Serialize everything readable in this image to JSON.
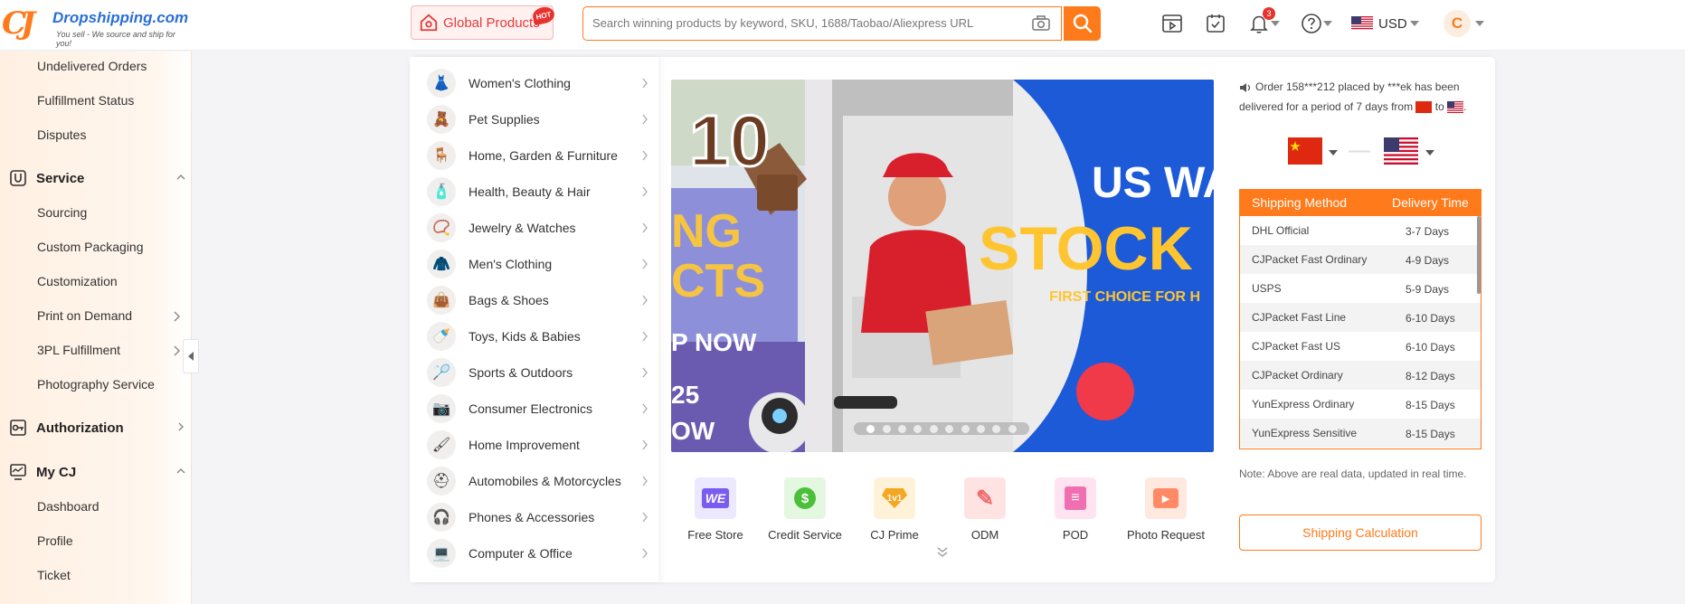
{
  "header": {
    "logo_mark": "CJ",
    "logo_name": "Dropshipping.com",
    "logo_tagline": "You sell - We source and ship for you!",
    "global_products_label": "Global Products",
    "hot_badge": "HOT",
    "search_placeholder": "Search winning products by keyword, SKU, 1688/Taobao/Aliexpress URL",
    "notification_count": "3",
    "currency": "USD",
    "avatar_initial": "C"
  },
  "sidebar": {
    "top_items": [
      "Undelivered Orders",
      "Fulfillment Status",
      "Disputes"
    ],
    "service": {
      "label": "Service",
      "items": [
        "Sourcing",
        "Custom Packaging",
        "Customization",
        "Print on Demand",
        "3PL Fulfillment",
        "Photography Service"
      ]
    },
    "authorization": {
      "label": "Authorization"
    },
    "my_cj": {
      "label": "My CJ",
      "items": [
        "Dashboard",
        "Profile",
        "Ticket"
      ]
    }
  },
  "categories": [
    "Women's Clothing",
    "Pet Supplies",
    "Home, Garden & Furniture",
    "Health, Beauty & Hair",
    "Jewelry & Watches",
    "Men's Clothing",
    "Bags & Shoes",
    "Toys, Kids & Babies",
    "Sports & Outdoors",
    "Consumer Electronics",
    "Home Improvement",
    "Automobiles & Motorcycles",
    "Phones & Accessories",
    "Computer & Office"
  ],
  "banner": {
    "left_number": "10",
    "left_line1": "NG",
    "left_line2": "CTS",
    "left_line3": "P NOW",
    "left_line4": "25",
    "left_line5": "OW",
    "headline1": "US WAR",
    "headline2": "STOCK DI",
    "subline": "FIRST CHOICE FOR H",
    "slide_count": 10,
    "active_slide": 1
  },
  "services": [
    {
      "label": "Free Store",
      "color": "#7b5cf0",
      "glyph": "WE"
    },
    {
      "label": "Credit Service",
      "color": "#4bbf3a",
      "glyph": "$"
    },
    {
      "label": "CJ Prime",
      "color": "#f5a623",
      "glyph": "1v1"
    },
    {
      "label": "ODM",
      "color": "#f26b6b",
      "glyph": "✎"
    },
    {
      "label": "POD",
      "color": "#f06fb0",
      "glyph": "≡"
    },
    {
      "label": "Photo Request",
      "color": "#ff8a65",
      "glyph": "▶"
    }
  ],
  "right_panel": {
    "notice_line1": "Order 158***212 placed by ***ek has been",
    "notice_line2": "delivered for a period of 7 days from",
    "notice_to": "to",
    "notice_end": ".",
    "table_header_method": "Shipping Method",
    "table_header_time": "Delivery Time",
    "rows": [
      {
        "method": "DHL Official",
        "time": "3-7 Days"
      },
      {
        "method": "CJPacket Fast Ordinary",
        "time": "4-9 Days"
      },
      {
        "method": "USPS",
        "time": "5-9 Days"
      },
      {
        "method": "CJPacket Fast Line",
        "time": "6-10 Days"
      },
      {
        "method": "CJPacket Fast US",
        "time": "6-10 Days"
      },
      {
        "method": "CJPacket Ordinary",
        "time": "8-12 Days"
      },
      {
        "method": "YunExpress Ordinary",
        "time": "8-15 Days"
      },
      {
        "method": "YunExpress Sensitive",
        "time": "8-15 Days"
      }
    ],
    "note": "Note: Above are real data, updated in real time.",
    "calc_button": "Shipping Calculation"
  },
  "colors": {
    "brand_orange": "#ff7a1a",
    "brand_blue": "#2a6fd6",
    "hot_red": "#e8322e"
  }
}
